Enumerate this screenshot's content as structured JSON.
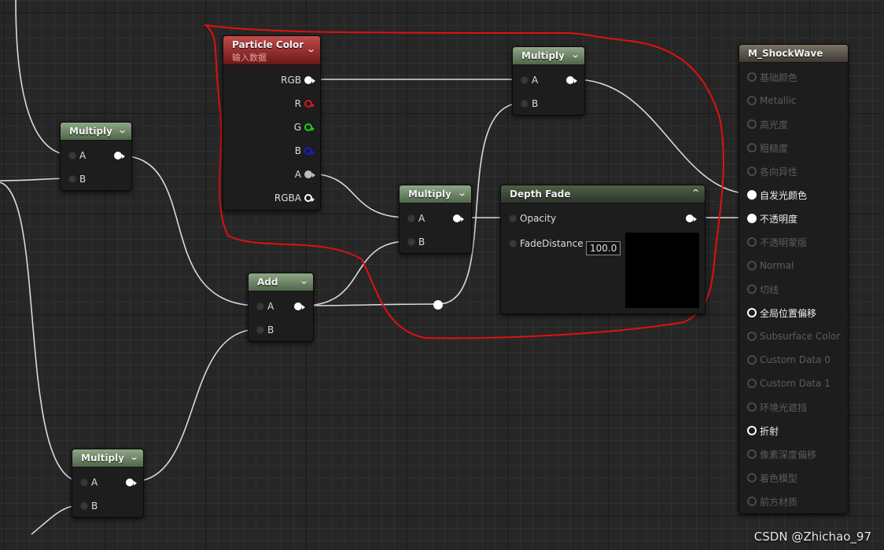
{
  "nodes": {
    "multiply_left": {
      "title": "Multiply",
      "pin_a": "A",
      "pin_b": "B"
    },
    "multiply_bottom": {
      "title": "Multiply",
      "pin_a": "A",
      "pin_b": "B"
    },
    "add": {
      "title": "Add",
      "pin_a": "A",
      "pin_b": "B"
    },
    "particle_color": {
      "title": "Particle Color",
      "subtitle": "输入数据",
      "outputs": [
        "RGB",
        "R",
        "G",
        "B",
        "A",
        "RGBA"
      ]
    },
    "multiply_middle": {
      "title": "Multiply",
      "pin_a": "A",
      "pin_b": "B"
    },
    "multiply_top": {
      "title": "Multiply",
      "pin_a": "A",
      "pin_b": "B"
    },
    "depth_fade": {
      "title": "Depth Fade",
      "opacity_label": "Opacity",
      "fade_distance_label": "FadeDistance",
      "fade_distance_value": "100.0"
    },
    "material": {
      "title": "M_ShockWave",
      "inputs": [
        {
          "label": "基础颜色",
          "state": "dim"
        },
        {
          "label": "Metallic",
          "state": "dim"
        },
        {
          "label": "高光度",
          "state": "dim"
        },
        {
          "label": "粗糙度",
          "state": "dim"
        },
        {
          "label": "各向异性",
          "state": "dim"
        },
        {
          "label": "自发光颜色",
          "state": "on"
        },
        {
          "label": "不透明度",
          "state": "on"
        },
        {
          "label": "不透明蒙版",
          "state": "dim"
        },
        {
          "label": "Normal",
          "state": "dim"
        },
        {
          "label": "切线",
          "state": "dim"
        },
        {
          "label": "全局位置偏移",
          "state": "ring"
        },
        {
          "label": "Subsurface Color",
          "state": "dim"
        },
        {
          "label": "Custom Data 0",
          "state": "dim"
        },
        {
          "label": "Custom Data 1",
          "state": "dim"
        },
        {
          "label": "环境光遮挡",
          "state": "dim"
        },
        {
          "label": "折射",
          "state": "ring"
        },
        {
          "label": "像素深度偏移",
          "state": "dim"
        },
        {
          "label": "着色模型",
          "state": "dim"
        },
        {
          "label": "前方材质",
          "state": "dim"
        }
      ]
    }
  },
  "icons": {
    "collapse": "chevron-down-icon",
    "expand": "chevron-up-icon"
  },
  "colors": {
    "highlight_outline": "#e01010",
    "wire": "#d9d9d9",
    "pin_r": "#d31a1a",
    "pin_g": "#1ccf1c",
    "pin_b": "#1a1ad6"
  },
  "watermark": "CSDN @Zhichao_97"
}
